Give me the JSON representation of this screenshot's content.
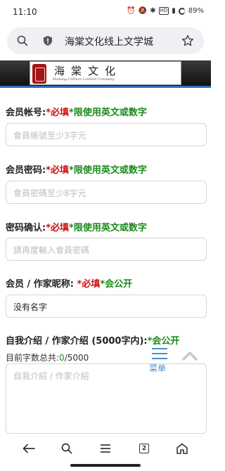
{
  "status_bar": {
    "time": "11:10",
    "hd_badge": "HD",
    "battery": "89%"
  },
  "browser": {
    "url_title": "海棠文化线上文学城"
  },
  "site": {
    "logo_name": "海棠文化",
    "logo_subtitle": "Haitang Culture Limited Company"
  },
  "form": {
    "account": {
      "label": "会员帐号:",
      "required": "*必填",
      "note": "*限使用英文或数字",
      "placeholder": "會員帳號至少3字元"
    },
    "password": {
      "label": "会员密码:",
      "required": "*必填",
      "note": "*限使用英文或数字",
      "placeholder": "會員密碼至少8字元"
    },
    "confirm": {
      "label": "密码确认:",
      "required": "*必填",
      "note": "*限使用英文或数字",
      "placeholder": "請再度輸入會員密碼"
    },
    "nickname": {
      "label": "会员 / 作家昵称:",
      "required": "*必填",
      "note": "*会公开",
      "value": "没有名字"
    },
    "intro": {
      "label": "自我介绍 / 作家介绍 (5000字内):",
      "note": "*会公开",
      "counter_label": "目前字数总共:",
      "counter_value": "0",
      "counter_max": "/5000",
      "placeholder": "自我介紹 / 作家介紹"
    }
  },
  "float_menu": {
    "label": "菜单"
  },
  "bottom_nav": {
    "tab_count": "2"
  },
  "colors": {
    "required": "#cc1010",
    "note": "#1a8a1a",
    "accent": "#4a8fd1",
    "header_line": "#2f6fb4"
  }
}
